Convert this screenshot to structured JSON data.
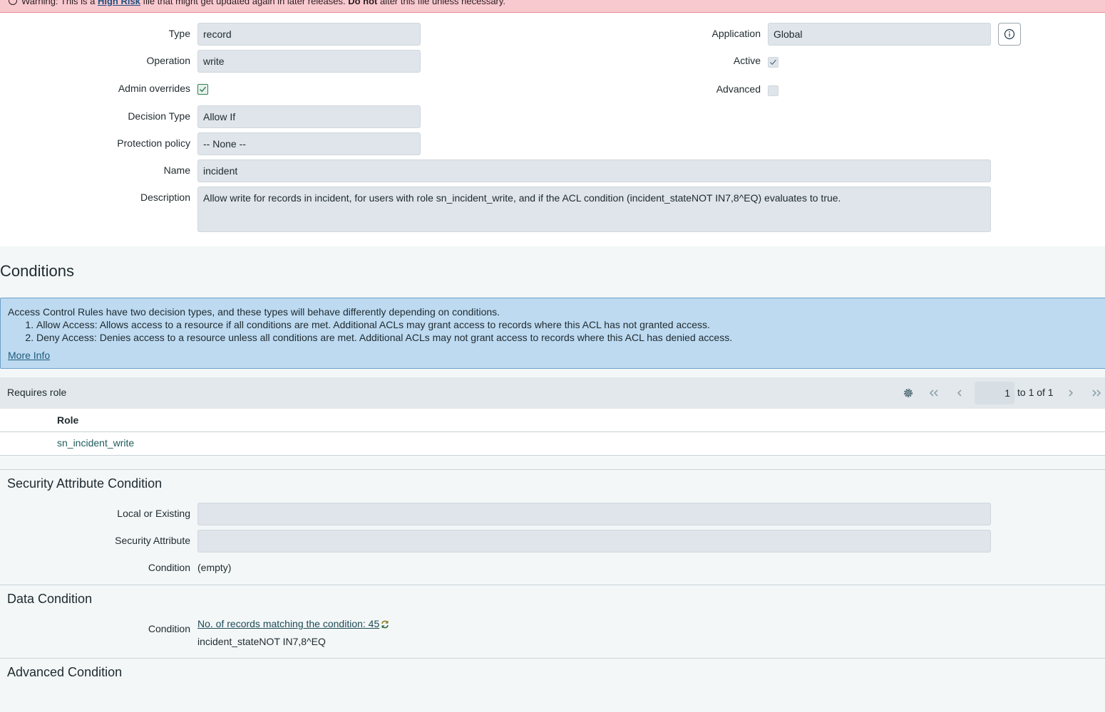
{
  "warning": {
    "prefix": "Warning: This is a",
    "link": "High Risk",
    "middle": "file that might get updated again in later releases.",
    "emphasis": "Do not",
    "suffix": "alter this file unless necessary."
  },
  "form": {
    "type": {
      "label": "Type",
      "value": "record"
    },
    "operation": {
      "label": "Operation",
      "value": "write"
    },
    "admin_overrides": {
      "label": "Admin overrides",
      "checked": true
    },
    "decision_type": {
      "label": "Decision Type",
      "value": "Allow If"
    },
    "protection_policy": {
      "label": "Protection policy",
      "value": "-- None --"
    },
    "name": {
      "label": "Name",
      "value": "incident"
    },
    "description": {
      "label": "Description",
      "value": "Allow write for records in incident, for users with role sn_incident_write, and if the ACL condition (incident_stateNOT IN7,8^EQ) evaluates to true."
    },
    "application": {
      "label": "Application",
      "value": "Global"
    },
    "active": {
      "label": "Active",
      "checked": true
    },
    "advanced": {
      "label": "Advanced",
      "checked": false
    }
  },
  "conditions": {
    "title": "Conditions",
    "info": {
      "intro": "Access Control Rules have two decision types, and these types will behave differently depending on conditions.",
      "items": [
        "Allow Access: Allows access to a resource if all conditions are met. Additional ACLs may grant access to records where this ACL has not granted access.",
        "Deny Access: Denies access to a resource unless all conditions are met. Additional ACLs may not grant access to records where this ACL has denied access."
      ],
      "more_info": "More Info"
    },
    "requires_role": {
      "title": "Requires role",
      "page": "1",
      "page_of": "to 1 of 1",
      "column": "Role",
      "rows": [
        "sn_incident_write"
      ]
    },
    "security_attribute": {
      "title": "Security Attribute Condition",
      "local_or_existing": {
        "label": "Local or Existing",
        "value": ""
      },
      "security_attribute": {
        "label": "Security Attribute",
        "value": ""
      },
      "condition": {
        "label": "Condition",
        "value": "(empty)"
      }
    },
    "data_condition": {
      "title": "Data Condition",
      "condition_label": "Condition",
      "match_link": "No. of records matching the condition: 45",
      "query": "incident_stateNOT IN7,8^EQ"
    },
    "advanced_condition": {
      "title": "Advanced Condition"
    }
  },
  "colors": {
    "warning_bg": "#f8c9cf",
    "field_bg": "#dfe5ea",
    "info_bg": "#bddaf1",
    "link": "#1f5b7a"
  }
}
